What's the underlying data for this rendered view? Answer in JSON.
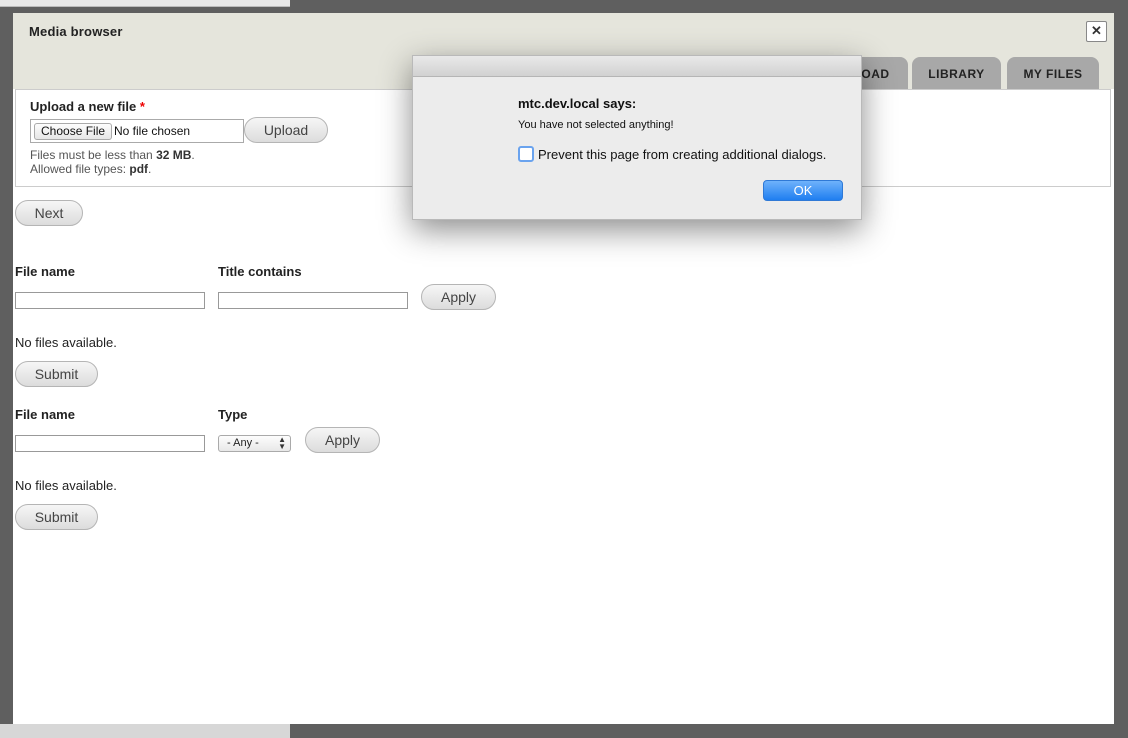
{
  "modal": {
    "title": "Media browser",
    "close_glyph": "✕",
    "tabs": [
      {
        "label": "UPLOAD",
        "visible_label": "OAD"
      },
      {
        "label": "LIBRARY"
      },
      {
        "label": "MY FILES"
      }
    ]
  },
  "upload": {
    "label": "Upload a new file",
    "required_marker": "*",
    "choose_button": "Choose File",
    "no_file_text": "No file chosen",
    "upload_button": "Upload",
    "size_hint_prefix": "Files must be less than",
    "size_hint_value": "32 MB",
    "size_hint_suffix": ".",
    "types_hint_prefix": "Allowed file types:",
    "types_hint_value": "pdf",
    "types_hint_suffix": "."
  },
  "next_button": "Next",
  "library_filter": {
    "file_name_label": "File name",
    "file_name_value": "",
    "title_label": "Title contains",
    "title_value": "",
    "apply_button": "Apply",
    "empty_text": "No files available.",
    "submit_button": "Submit"
  },
  "myfiles_filter": {
    "file_name_label": "File name",
    "file_name_value": "",
    "type_label": "Type",
    "type_selected": "- Any -",
    "apply_button": "Apply",
    "empty_text": "No files available.",
    "submit_button": "Submit"
  },
  "alert": {
    "heading": "mtc.dev.local says:",
    "message": "You have not selected anything!",
    "checkbox_label": "Prevent this page from creating additional dialogs.",
    "checkbox_checked": false,
    "ok_button": "OK",
    "accent_color": "#1f7ef0"
  }
}
